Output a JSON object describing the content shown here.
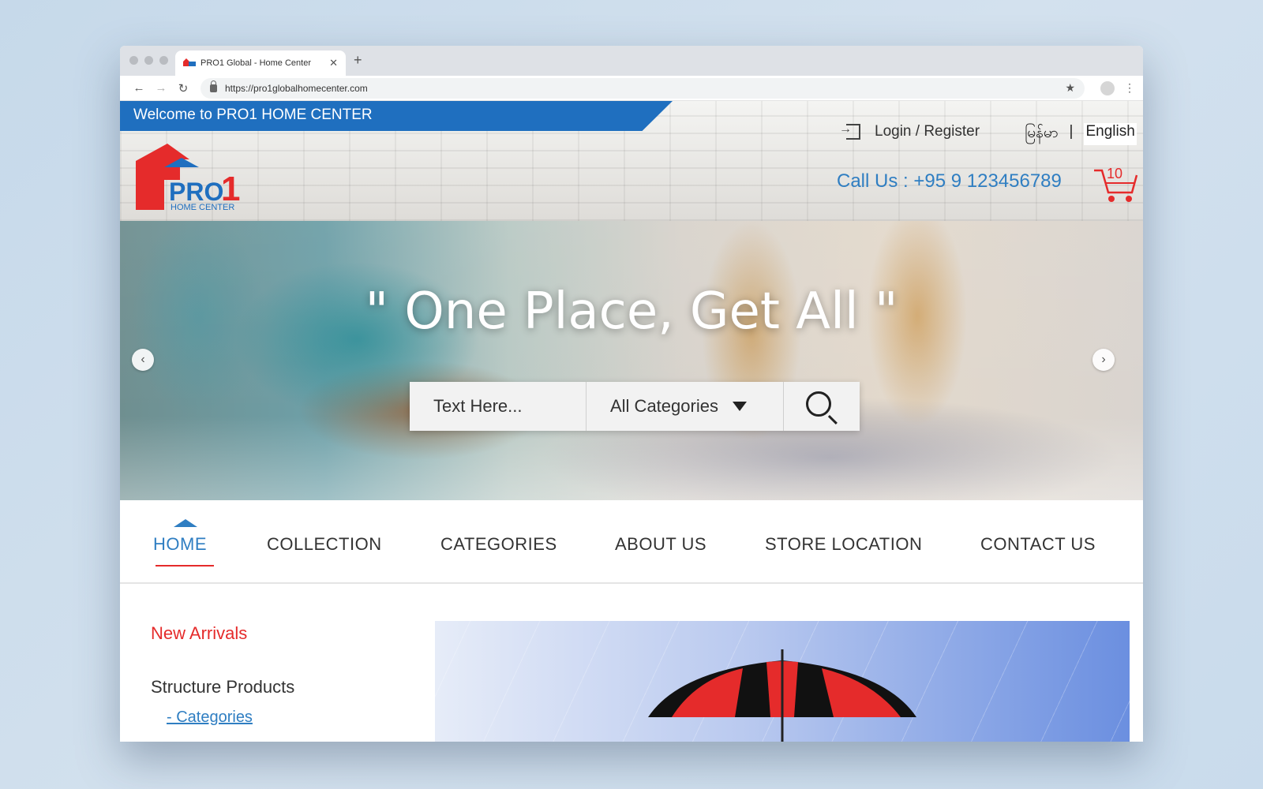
{
  "browser": {
    "tab_title": "PRO1 Global - Home Center",
    "tab_close": "✕",
    "new_tab": "+",
    "url": "https://pro1globalhomecenter.com"
  },
  "header": {
    "welcome": "Welcome to PRO1 HOME CENTER",
    "login": "Login / Register",
    "lang_mm": "မြန်မာ",
    "lang_sep": "|",
    "lang_en": "English",
    "logo_text": "PRO",
    "logo_digit": "1",
    "logo_sub": "HOME CENTER",
    "call": "Call Us : +95 9 123456789",
    "cart_count": "10"
  },
  "hero": {
    "quote": "\"  One Place, Get All \"",
    "search_placeholder": "Text Here...",
    "category": "All Categories",
    "prev": "‹",
    "next": "›"
  },
  "nav": {
    "items": [
      "HOME",
      "COLLECTION",
      "CATEGORIES",
      "ABOUT US",
      "STORE LOCATION",
      "CONTACT US"
    ],
    "active_index": 0
  },
  "sidebar": {
    "new_arrivals": "New Arrivals",
    "structure": "Structure Products",
    "categories": "- Categories"
  },
  "colors": {
    "brand_blue": "#1f6fbf",
    "accent_red": "#e52b2b",
    "link_blue": "#2f7ec2"
  }
}
